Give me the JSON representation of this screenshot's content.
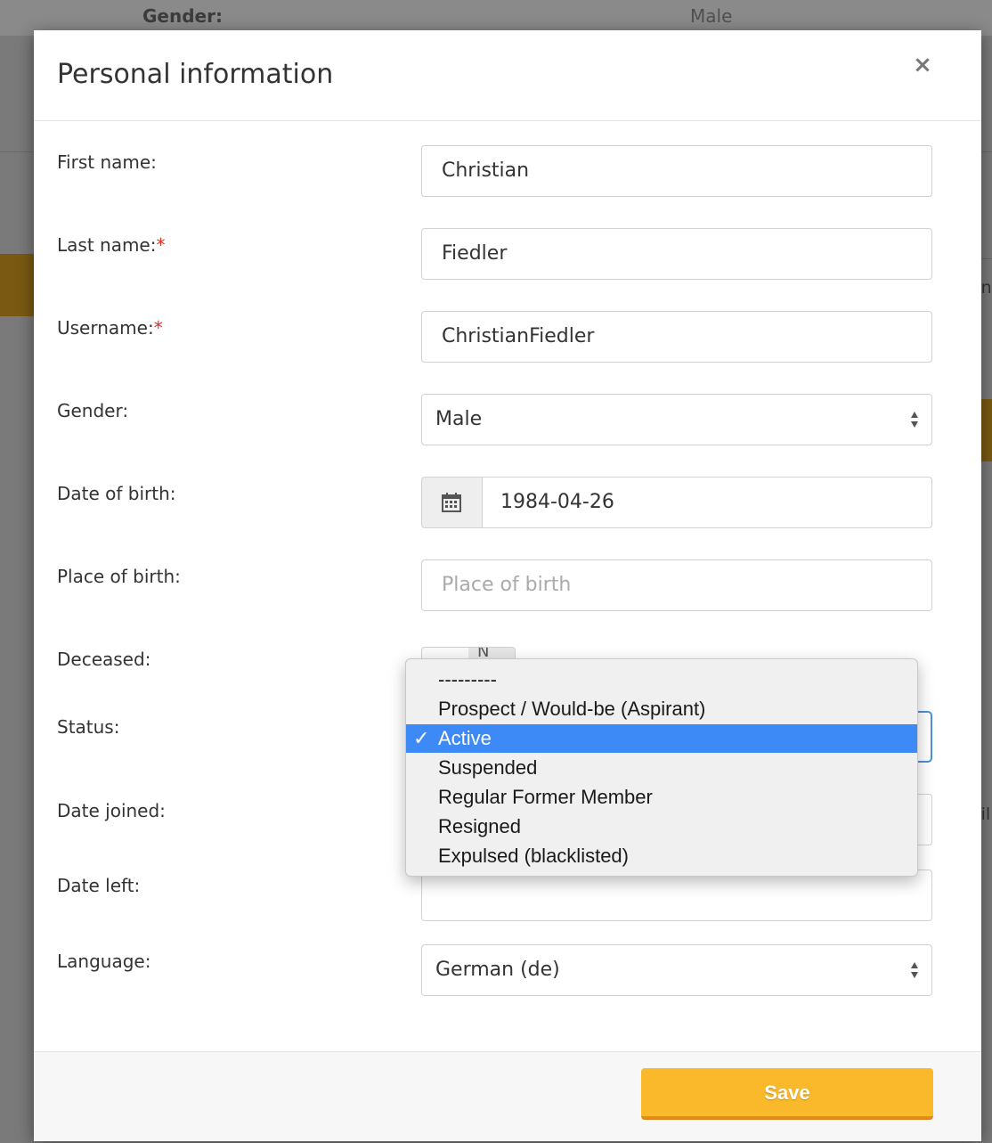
{
  "background": {
    "gender_label": "Gender:",
    "gender_value": "Male",
    "peek_right_1": "and",
    "peek_right_2": "ail."
  },
  "modal": {
    "title": "Personal information",
    "close_glyph": "×"
  },
  "form": {
    "first_name": {
      "label": "First name:",
      "value": "Christian"
    },
    "last_name": {
      "label": "Last name:",
      "required_mark": "*",
      "value": "Fiedler"
    },
    "username": {
      "label": "Username:",
      "required_mark": "*",
      "value": "ChristianFiedler"
    },
    "gender": {
      "label": "Gender:",
      "value": "Male"
    },
    "date_of_birth": {
      "label": "Date of birth:",
      "value": "1984-04-26",
      "icon": "calendar-icon"
    },
    "place_of_birth": {
      "label": "Place of birth:",
      "placeholder": "Place of birth"
    },
    "deceased": {
      "label": "Deceased:",
      "toggle_text": "N"
    },
    "status": {
      "label": "Status:"
    },
    "date_joined": {
      "label": "Date joined:"
    },
    "date_left": {
      "label": "Date left:"
    },
    "language": {
      "label": "Language:",
      "value": "German (de)"
    }
  },
  "status_dropdown": {
    "options": [
      "---------",
      "Prospect / Would-be (Aspirant)",
      "Active",
      "Suspended",
      "Regular Former Member",
      "Resigned",
      "Expulsed (blacklisted)"
    ],
    "selected_index": 2,
    "check_glyph": "✓",
    "selected_color": "#3d8af7"
  },
  "footer": {
    "save_label": "Save",
    "save_color": "#f9b92a"
  }
}
